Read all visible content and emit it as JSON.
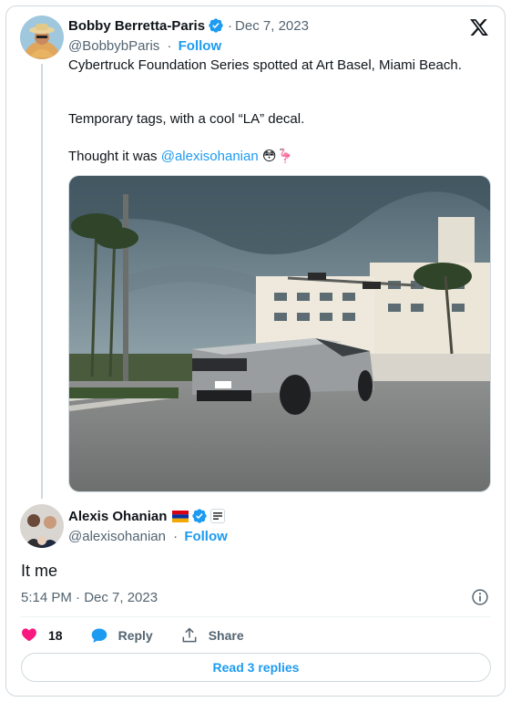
{
  "colors": {
    "accent": "#1d9bf0",
    "text_primary": "#0f1419",
    "text_secondary": "#536471",
    "border": "#cfd9de",
    "like_heart": "#f91880"
  },
  "parent_tweet": {
    "author_name": "Bobby Berretta-Paris",
    "verified_icon": "verified-badge-icon",
    "date": "Dec 7, 2023",
    "handle": "@BobbybParis",
    "follow_label": "Follow",
    "brand_icon": "x-logo-icon",
    "lines": [
      "Cybertruck Foundation Series spotted at Art Basel, Miami Beach.",
      "Temporary tags, with a cool “LA” decal."
    ],
    "line3_prefix": "Thought it was ",
    "mention": "@alexisohanian",
    "emojis": "😳🦩",
    "media_description_icon": "photo-media"
  },
  "reply_tweet": {
    "author_name": "Alexis Ohanian",
    "flag_icon": "armenia-flag-icon",
    "verified_icon": "verified-badge-icon",
    "affiliate_icon": "affiliate-badge-icon",
    "handle": "@alexisohanian",
    "follow_label": "Follow",
    "text": "It me",
    "timestamp": "5:14 PM · Dec 7, 2023",
    "info_icon": "info-icon"
  },
  "actions": {
    "like_count": "18",
    "reply_label": "Reply",
    "share_label": "Share"
  },
  "read_replies_label": "Read 3 replies"
}
